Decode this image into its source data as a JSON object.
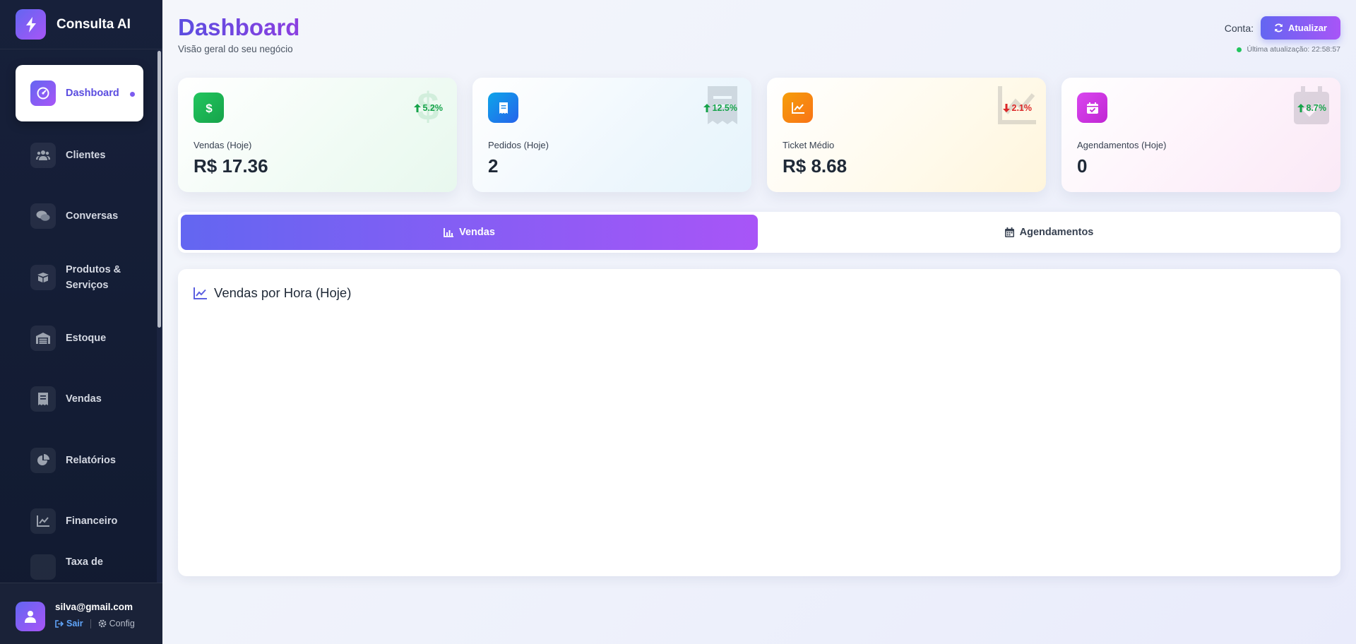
{
  "app": {
    "name": "Consulta AI"
  },
  "sidebar": {
    "items": [
      {
        "label": "Dashboard",
        "icon": "gauge-icon",
        "active": true
      },
      {
        "label": "Clientes",
        "icon": "users-icon"
      },
      {
        "label": "Conversas",
        "icon": "chat-icon"
      },
      {
        "label": "Produtos & Serviços",
        "icon": "box-icon"
      },
      {
        "label": "Estoque",
        "icon": "warehouse-icon"
      },
      {
        "label": "Vendas",
        "icon": "receipt-icon"
      },
      {
        "label": "Relatórios",
        "icon": "pie-chart-icon"
      },
      {
        "label": "Financeiro",
        "icon": "line-chart-icon"
      },
      {
        "label": "Taxa de",
        "icon": "percent-icon"
      }
    ]
  },
  "user": {
    "email": "silva@gmail.com",
    "logout_label": "Sair",
    "config_label": "Config"
  },
  "header": {
    "title": "Dashboard",
    "subtitle": "Visão geral do seu negócio",
    "account_label": "Conta:",
    "refresh_label": "Atualizar",
    "last_update": "Última atualização: 22:58:57"
  },
  "stats": [
    {
      "label": "Vendas (Hoje)",
      "value": "R$ 17.36",
      "trend": "5.2%",
      "direction": "up",
      "icon": "dollar-icon",
      "color": "#16a34a"
    },
    {
      "label": "Pedidos (Hoje)",
      "value": "2",
      "trend": "12.5%",
      "direction": "up",
      "icon": "receipt-icon",
      "color": "#0ea5e9"
    },
    {
      "label": "Ticket Médio",
      "value": "R$ 8.68",
      "trend": "2.1%",
      "direction": "down",
      "icon": "line-chart-icon",
      "color": "#f59e0b"
    },
    {
      "label": "Agendamentos (Hoje)",
      "value": "0",
      "trend": "8.7%",
      "direction": "up",
      "icon": "calendar-check-icon",
      "color": "#c026d3"
    }
  ],
  "tabs": [
    {
      "label": "Vendas",
      "icon": "bar-chart-icon",
      "active": true
    },
    {
      "label": "Agendamentos",
      "icon": "calendar-icon",
      "active": false
    }
  ],
  "chart": {
    "title": "Vendas por Hora (Hoje)",
    "icon": "line-chart-icon"
  },
  "colors": {
    "accent_start": "#6366f1",
    "accent_end": "#a855f7",
    "sidebar_bg": "#17203a",
    "online": "#22c55e"
  }
}
